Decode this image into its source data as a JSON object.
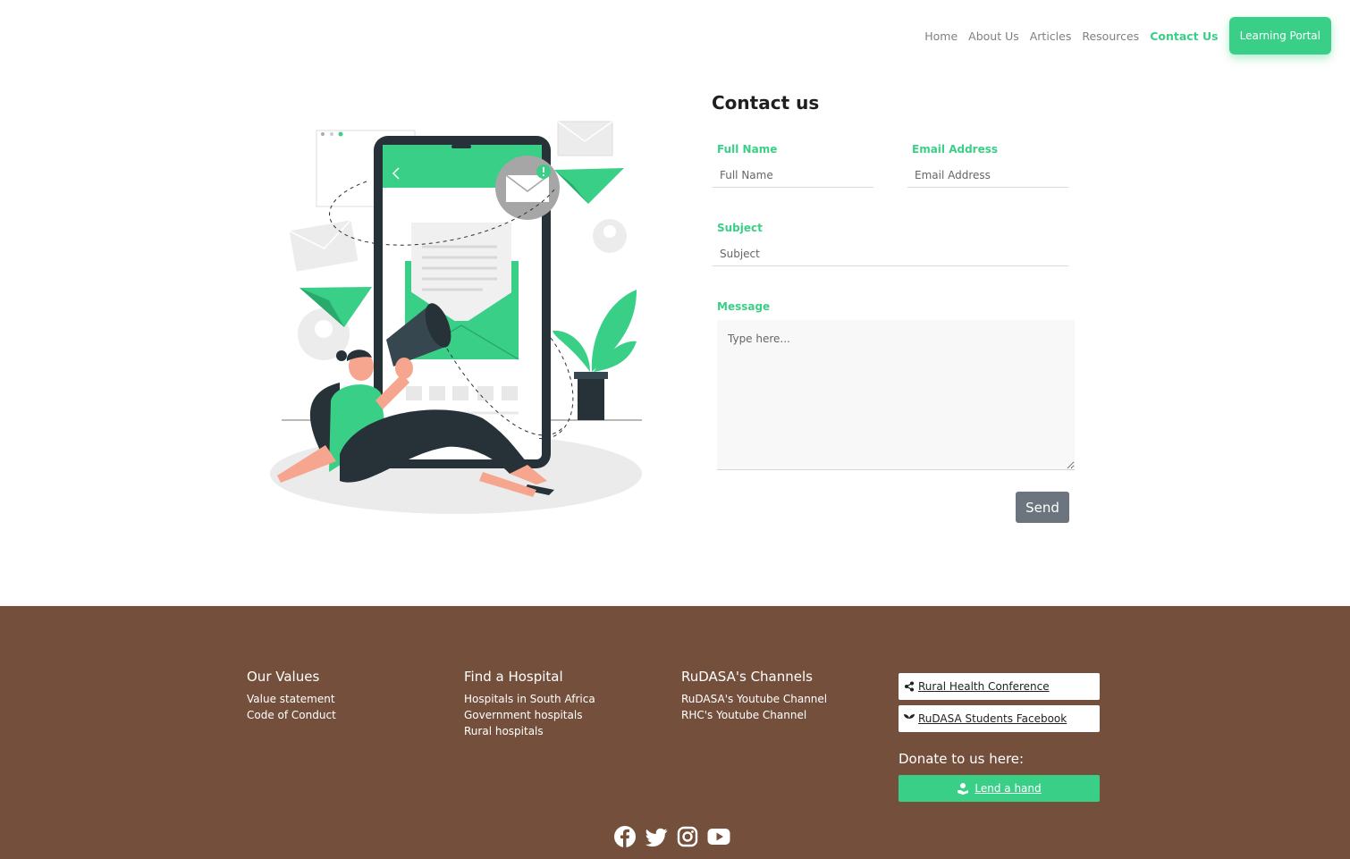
{
  "nav": {
    "items": [
      {
        "label": "Home"
      },
      {
        "label": "About Us"
      },
      {
        "label": "Articles"
      },
      {
        "label": "Resources"
      },
      {
        "label": "Contact Us",
        "active": true
      }
    ],
    "portal_label": "Learning Portal"
  },
  "form": {
    "title": "Contact us",
    "full_name_label": "Full Name",
    "full_name_placeholder": "Full Name",
    "email_label": "Email Address",
    "email_placeholder": "Email Address",
    "subject_label": "Subject",
    "subject_placeholder": "Subject",
    "message_label": "Message",
    "message_placeholder": "Type here...",
    "send_label": "Send"
  },
  "footer": {
    "values": {
      "title": "Our Values",
      "links": [
        "Value statement",
        "Code of Conduct"
      ]
    },
    "hospital": {
      "title": "Find a Hospital",
      "links": [
        "Hospitals in South Africa",
        "Government hospitals",
        "Rural hospitals"
      ]
    },
    "channels": {
      "title": "RuDASA's Channels",
      "links": [
        "RuDASA's Youtube Channel",
        "RHC's Youtube Channel"
      ]
    },
    "chips": [
      {
        "label": "Rural Health Conference",
        "icon": "share-icon"
      },
      {
        "label": "RuDASA Students Facebook",
        "icon": "seedling-icon"
      }
    ],
    "donate_text": "Donate to us here:",
    "lend_label": "Lend a hand",
    "socials": [
      "facebook-icon",
      "twitter-icon",
      "instagram-icon",
      "youtube-icon"
    ]
  },
  "colors": {
    "accent": "#3acf87",
    "footer_bg": "#74503c",
    "send_bg": "#6c757d"
  }
}
